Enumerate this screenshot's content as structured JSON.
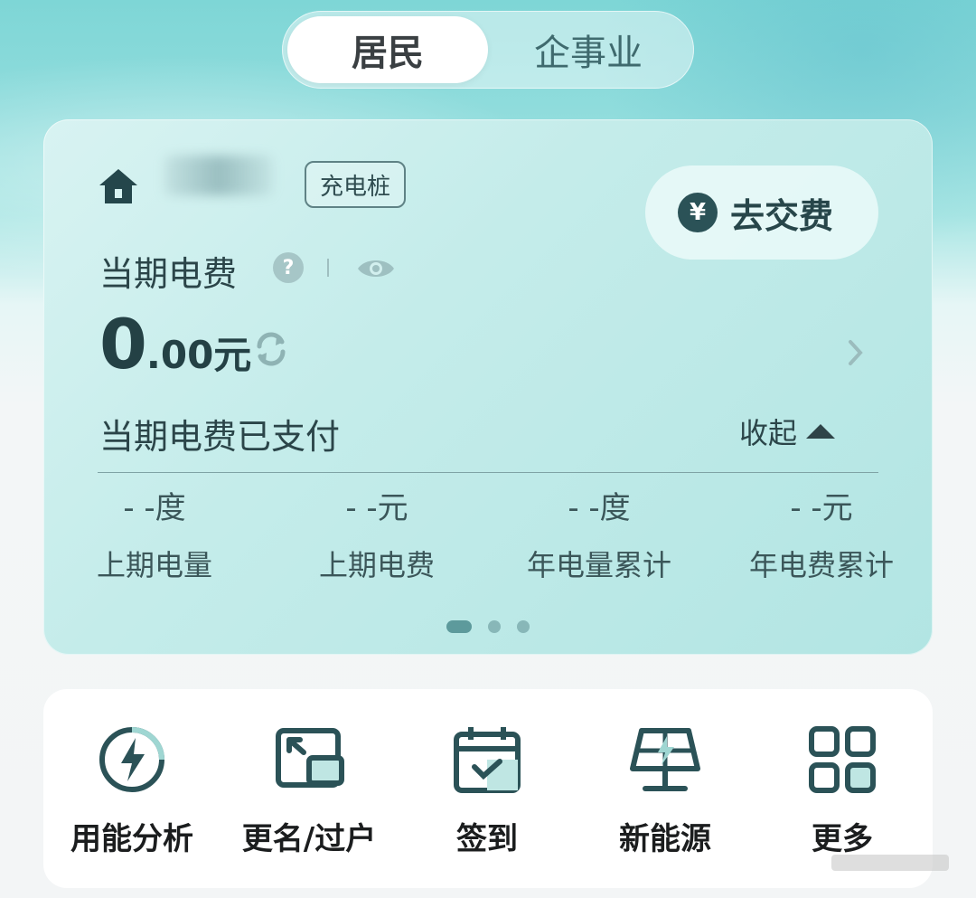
{
  "customer_type_tabs": {
    "active": "居民",
    "inactive": "企事业"
  },
  "account": {
    "tag": "充电桩"
  },
  "pay_button": {
    "icon": "yen-icon",
    "label": "去交费"
  },
  "bill": {
    "label": "当期电费",
    "amount_int": "0",
    "amount_dec": ".00元",
    "status": "当期电费已支付",
    "collapse_label": "收起"
  },
  "stats": [
    {
      "value": "- -度",
      "label": "上期电量"
    },
    {
      "value": "- -元",
      "label": "上期电费"
    },
    {
      "value": "- -度",
      "label": "年电量累计"
    },
    {
      "value": "- -元",
      "label": "年电费累计"
    }
  ],
  "carousel": {
    "count": 3,
    "active": 0
  },
  "services": [
    {
      "icon": "energy-analysis-icon",
      "label": "用能分析"
    },
    {
      "icon": "rename-transfer-icon",
      "label": "更名/过户"
    },
    {
      "icon": "calendar-check-icon",
      "label": "签到"
    },
    {
      "icon": "solar-panel-icon",
      "label": "新能源"
    },
    {
      "icon": "grid-more-icon",
      "label": "更多"
    }
  ],
  "colors": {
    "accent": "#2b5257",
    "card_bg": "#c4ecea",
    "background_top": "#7ed6d6"
  }
}
